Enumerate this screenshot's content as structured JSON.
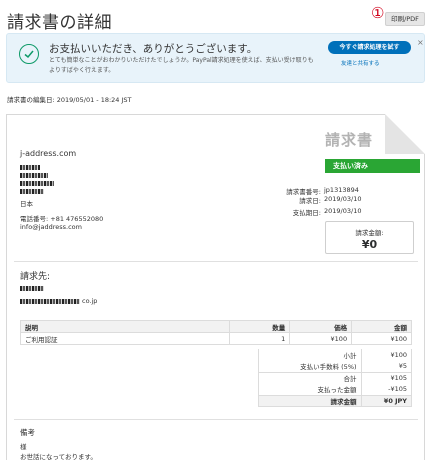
{
  "header": {
    "title": "請求書の詳細",
    "marker": "①",
    "print_label": "印刷/PDF"
  },
  "banner": {
    "title": "お支払いいただき、ありがとうございます。",
    "body": "とても簡単なことがおわかりいただけたでしょうか。PayPal請求処理を使えば、支払い受け取りもよりすばやく行えます。",
    "cta_label": "今すぐ請求処理を試す",
    "share_label": "友達と共有する",
    "close_label": "×"
  },
  "edited_date": "請求書の編集日: 2019/05/01 - 18:24 JST",
  "invoice": {
    "title": "請求書",
    "status": "支払い済み",
    "seller": {
      "name": "j-address.com",
      "country": "日本",
      "phone": "電話番号:  +81 476552080",
      "email": "info@jaddress.com"
    },
    "meta": [
      {
        "label": "請求書番号:",
        "value": "jp1313894"
      },
      {
        "label": "請求日:",
        "value": "2019/03/10"
      },
      {
        "label": "支払期日:",
        "value": "2019/03/10"
      }
    ],
    "amount_label": "請求金額:",
    "amount_value": "¥0",
    "bill_to_title": "請求先:",
    "bill_to_domain_suffix": "co.jp",
    "columns": {
      "desc": "説明",
      "qty": "数量",
      "price": "価格",
      "amount": "金額"
    },
    "items": [
      {
        "desc": "ご利用認証",
        "qty": "1",
        "price": "¥100",
        "amount": "¥100"
      }
    ],
    "totals": {
      "subtotal_label": "小計",
      "subtotal_value": "¥100",
      "fee_label": "支払い手数料 (5%)",
      "fee_value": "¥5",
      "total_label": "合計",
      "total_value": "¥105",
      "paid_label": "支払った金額",
      "paid_value": "-¥105",
      "due_label": "請求金額",
      "due_value": "¥0 JPY"
    },
    "notes_title": "備考",
    "notes_lines": [
      "様",
      "お世話になっております。"
    ]
  },
  "colors": {
    "accent_blue": "#0070ba",
    "paid_green": "#2aa634",
    "banner_bg": "#e8f3fa",
    "marker_red": "#d0021b"
  },
  "icons": {
    "banner_check": "check-circle-icon",
    "banner_close": "close-icon"
  }
}
